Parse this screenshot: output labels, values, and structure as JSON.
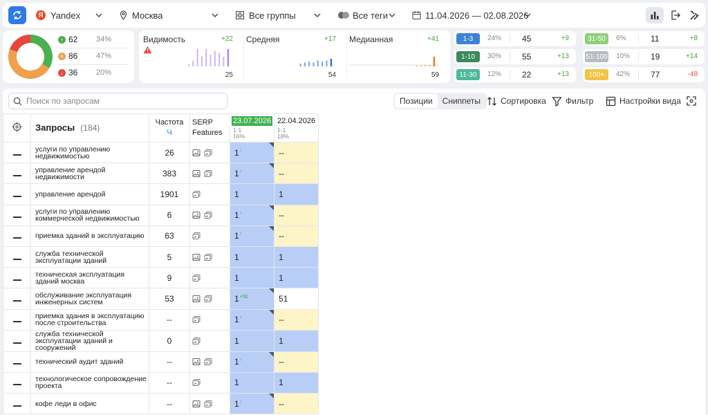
{
  "toolbar": {
    "engine": "Yandex",
    "engine_logo": "Я",
    "region": "Москва",
    "groups": "Все группы",
    "tags": "Все теги",
    "period": "11.04.2026 — 02.08.2026"
  },
  "donut": {
    "colors": [
      "#4caf50",
      "#f0a04b",
      "#e8473d"
    ],
    "rows": [
      {
        "value": "62",
        "pct": "34%",
        "color": "#4caf50",
        "symbol": "↑"
      },
      {
        "value": "86",
        "pct": "47%",
        "color": "#f0a04b",
        "symbol": "="
      },
      {
        "value": "36",
        "pct": "20%",
        "color": "#e8473d",
        "symbol": "↓"
      }
    ]
  },
  "metrics": [
    {
      "title": "Видимость",
      "delta": "+22",
      "value": "25",
      "warning": true,
      "color": "#a78bdc"
    },
    {
      "title": "Средняя",
      "delta": "+17",
      "value": "54",
      "warning": false,
      "color": "#7a9fe8"
    },
    {
      "title": "Медианная",
      "delta": "+41",
      "value": "59",
      "warning": false,
      "color": "#f0a04b"
    }
  ],
  "ranges_left": [
    {
      "label": "1-3",
      "pct": "24%",
      "count": "45",
      "delta": "+9",
      "color": "#3d82d6",
      "delta_color": "#3aa83a"
    },
    {
      "label": "1-10",
      "pct": "30%",
      "count": "55",
      "delta": "+13",
      "color": "#3a8a5c",
      "delta_color": "#3aa83a"
    },
    {
      "label": "11-30",
      "pct": "12%",
      "count": "22",
      "delta": "+13",
      "color": "#4bb89a",
      "delta_color": "#3aa83a"
    }
  ],
  "ranges_right": [
    {
      "label": "31-50",
      "pct": "6%",
      "count": "11",
      "delta": "+8",
      "color": "#8fd07a",
      "delta_color": "#3aa83a"
    },
    {
      "label": "51-100",
      "pct": "10%",
      "count": "19",
      "delta": "+14",
      "color": "#b8bcc2",
      "delta_color": "#3aa83a"
    },
    {
      "label": "100+",
      "pct": "42%",
      "count": "77",
      "delta": "-48",
      "color": "#f5c242",
      "delta_color": "#e8473d"
    }
  ],
  "search": {
    "placeholder": "Поиск по запросам"
  },
  "view_tabs": [
    "Позиции",
    "Сниппеты"
  ],
  "tools": {
    "sort": "Сортировка",
    "filter": "Фильтр",
    "view": "Настройки вида"
  },
  "table": {
    "header": {
      "queries": "Запросы",
      "queries_count": "(184)",
      "freq": "Частота",
      "freq_sub": "Ч",
      "serp_1": "SERP",
      "serp_2": "Features",
      "date1": "23.07.2026",
      "date1_sub1": "1-1",
      "date1_sub2": "16%",
      "date2": "22.04.2026",
      "date2_sub1": "1-1",
      "date2_sub2": "18%"
    },
    "rows": [
      {
        "q": "услуги по управлению недвижимостью",
        "f": "26",
        "img": true,
        "p1": "1",
        "up": "↑",
        "p2": "--",
        "c2": "yellow",
        "corner": true
      },
      {
        "q": "управление арендой недвижимости",
        "f": "383",
        "img": true,
        "p1": "1",
        "up": "↑",
        "p2": "--",
        "c2": "yellow",
        "corner": true
      },
      {
        "q": "управление арендой",
        "f": "1901",
        "img": false,
        "p1": "1",
        "up": "",
        "p2": "1",
        "c2": "blue",
        "corner": false
      },
      {
        "q": "услуги по управлению коммерческой недвижимостью",
        "f": "6",
        "img": true,
        "p1": "1",
        "up": "↑",
        "p2": "--",
        "c2": "yellow",
        "corner": true
      },
      {
        "q": "приемка зданий в эксплуатацию",
        "f": "63",
        "img": false,
        "p1": "1",
        "up": "↑",
        "p2": "--",
        "c2": "yellow",
        "corner": true
      },
      {
        "q": "служба технической эксплуатации зданий",
        "f": "5",
        "img": true,
        "p1": "1",
        "up": "",
        "p2": "1",
        "c2": "blue",
        "corner": false
      },
      {
        "q": "техническая эксплуатация зданий москва",
        "f": "9",
        "img": false,
        "p1": "1",
        "up": "",
        "p2": "1",
        "c2": "blue",
        "corner": false
      },
      {
        "q": "обслуживание эксплуатация инженерных систем",
        "f": "53",
        "img": true,
        "p1": "1",
        "up": "+50",
        "p2": "51",
        "c2": "white",
        "corner": true
      },
      {
        "q": "приемка здания в эксплуатацию после строительства",
        "f": "--",
        "img": false,
        "p1": "1",
        "up": "↑",
        "p2": "--",
        "c2": "yellow",
        "corner": true
      },
      {
        "q": "служба технической эксплуатации зданий и сооружений",
        "f": "0",
        "img": false,
        "p1": "1",
        "up": "",
        "p2": "1",
        "c2": "blue",
        "corner": false
      },
      {
        "q": "технический аудит зданий",
        "f": "--",
        "img": true,
        "p1": "1",
        "up": "↑",
        "p2": "--",
        "c2": "yellow",
        "corner": true
      },
      {
        "q": "технологическое сопровождение проекта",
        "f": "--",
        "img": false,
        "p1": "1",
        "up": "",
        "p2": "1",
        "c2": "blue",
        "corner": false
      },
      {
        "q": "кофе леди в офис",
        "f": "--",
        "img": true,
        "p1": "1",
        "up": "↑",
        "p2": "--",
        "c2": "yellow",
        "corner": true
      }
    ]
  }
}
